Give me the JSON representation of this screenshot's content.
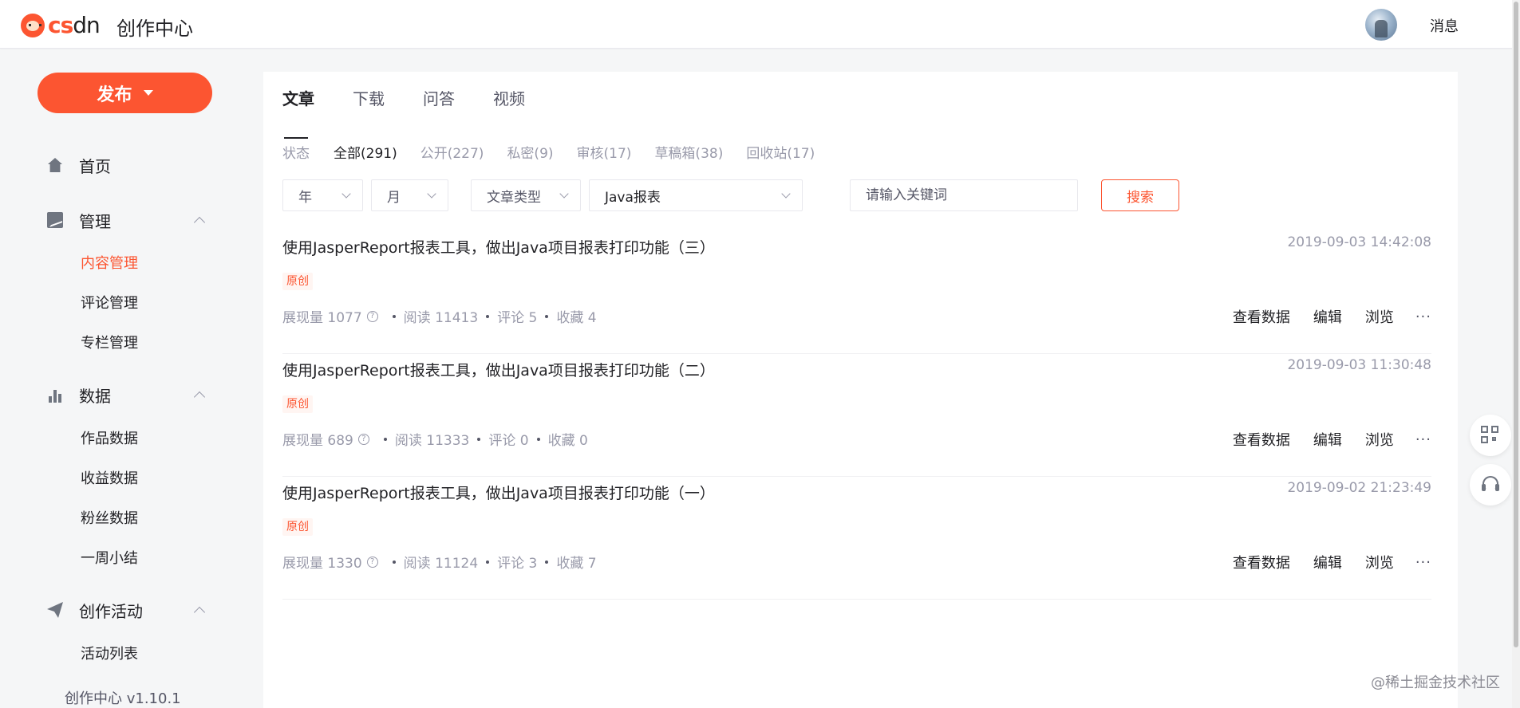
{
  "header": {
    "logo_text_brand": "cs",
    "logo_text_rest": "dn",
    "site_title": "创作中心",
    "messages_label": "消息"
  },
  "sidebar": {
    "publish_label": "发布",
    "home_label": "首页",
    "groups": [
      {
        "label": "管理",
        "items": [
          "内容管理",
          "评论管理",
          "专栏管理"
        ]
      },
      {
        "label": "数据",
        "items": [
          "作品数据",
          "收益数据",
          "粉丝数据",
          "一周小结"
        ]
      },
      {
        "label": "创作活动",
        "items": [
          "活动列表"
        ]
      }
    ],
    "active_item": "内容管理",
    "version": "创作中心 v1.10.1"
  },
  "main": {
    "tabs": [
      "文章",
      "下载",
      "问答",
      "视频"
    ],
    "active_tab": "文章",
    "status_label": "状态",
    "status_items": [
      "全部(291)",
      "公开(227)",
      "私密(9)",
      "审核(17)",
      "草稿箱(38)",
      "回收站(17)"
    ],
    "active_status": "全部(291)",
    "filters": {
      "year": "年",
      "month": "月",
      "article_type": "文章类型",
      "column": "Java报表",
      "search_placeholder": "请输入关键词",
      "search_button": "搜索"
    },
    "articles": [
      {
        "title": "使用JasperReport报表工具，做出Java项目报表打印功能（三）",
        "date": "2019-09-03 14:42:08",
        "tag": "原创",
        "impressions": "展现量 1077",
        "reads": "阅读 11413",
        "comments": "评论 5",
        "favorites": "收藏 4"
      },
      {
        "title": "使用JasperReport报表工具，做出Java项目报表打印功能（二）",
        "date": "2019-09-03 11:30:48",
        "tag": "原创",
        "impressions": "展现量 689",
        "reads": "阅读 11333",
        "comments": "评论 0",
        "favorites": "收藏 0"
      },
      {
        "title": "使用JasperReport报表工具，做出Java项目报表打印功能（一）",
        "date": "2019-09-02 21:23:49",
        "tag": "原创",
        "impressions": "展现量 1330",
        "reads": "阅读 11124",
        "comments": "评论 3",
        "favorites": "收藏 7"
      }
    ],
    "actions": {
      "view_data": "查看数据",
      "edit": "编辑",
      "browse": "浏览",
      "more": "···"
    }
  },
  "watermark": "@稀土掘金技术社区",
  "colors": {
    "accent": "#fc5531",
    "text": "#222226",
    "muted": "#999aaa"
  }
}
